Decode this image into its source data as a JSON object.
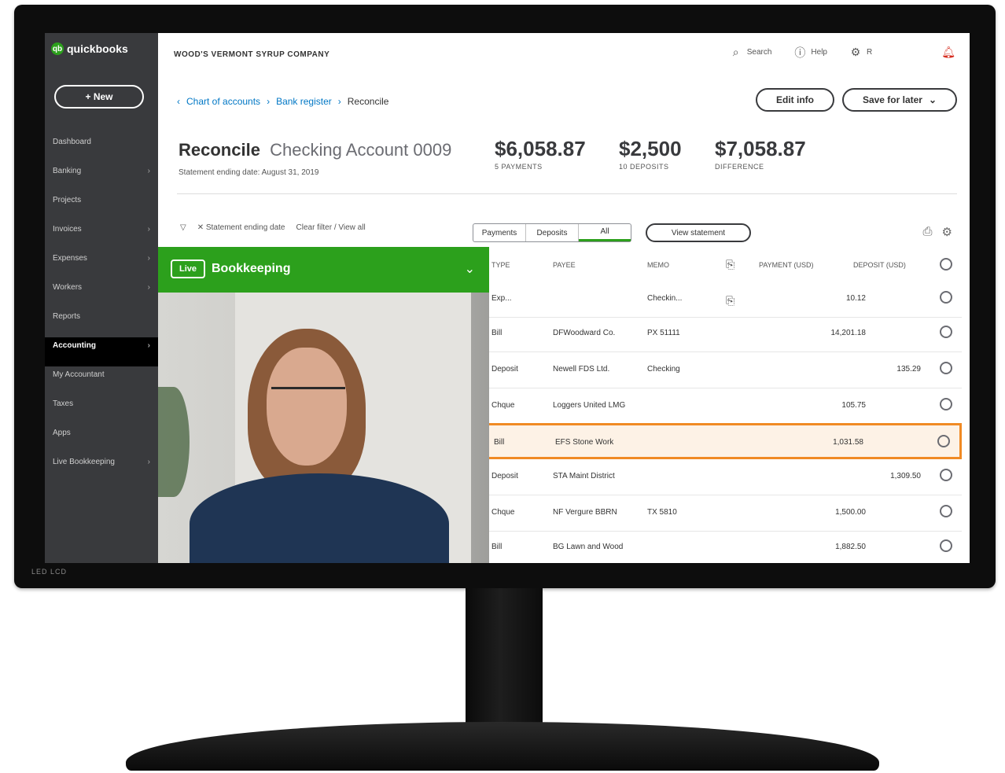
{
  "monitor": {
    "brand_text": "LED LCD"
  },
  "app": {
    "logo_text": "quickbooks",
    "new_button": "+ New",
    "company": "WOOD'S VERMONT SYRUP COMPANY",
    "search": "Search",
    "help": "Help",
    "account": "R"
  },
  "sidebar": {
    "items": [
      {
        "label": "Dashboard",
        "chevron": ""
      },
      {
        "label": "Banking",
        "chevron": "›"
      },
      {
        "label": "Projects",
        "chevron": ""
      },
      {
        "label": "Invoices",
        "chevron": "›"
      },
      {
        "label": "Expenses",
        "chevron": "›"
      },
      {
        "label": "Workers",
        "chevron": "›"
      },
      {
        "label": "Reports",
        "chevron": ""
      },
      {
        "label": "Accounting",
        "chevron": "›"
      },
      {
        "label": "My Accountant",
        "chevron": ""
      },
      {
        "label": "Taxes",
        "chevron": ""
      },
      {
        "label": "Apps",
        "chevron": ""
      },
      {
        "label": "Live Bookkeeping",
        "chevron": "›"
      }
    ]
  },
  "breadcrumb": {
    "back": "‹",
    "crumb1": "Chart of accounts",
    "crumb2": "Bank register",
    "current": "Reconcile",
    "sep": "›"
  },
  "buttons": {
    "edit_info": "Edit info",
    "save_later": "Save for later"
  },
  "reconcile": {
    "title_bold": "Reconcile",
    "title_account": "Checking Account 0009",
    "statement_date": "Statement ending date: August 31, 2019",
    "payments_amount": "$6,058.87",
    "payments_label": "5 PAYMENTS",
    "deposits_amount": "$2,500",
    "deposits_label": "10 DEPOSITS",
    "difference_amount": "$7,058.87",
    "difference_label": "DIFFERENCE"
  },
  "filters": {
    "filter_icon": "▽",
    "statement_filter": "✕ Statement ending date",
    "clear": "Clear filter / View all",
    "tabs": [
      "Payments",
      "Deposits",
      "All"
    ],
    "view_statement": "View statement"
  },
  "table": {
    "headers": {
      "type": "TYPE",
      "payee": "PAYEE",
      "memo": "MEMO",
      "payment": "PAYMENT (USD)",
      "deposit": "DEPOSIT (USD)"
    },
    "rows": [
      {
        "type": "Exp...",
        "payee": "",
        "memo": "Checkin...",
        "payment": "10.12",
        "deposit": "",
        "memo_icon": true
      },
      {
        "type": "Bill",
        "payee": "DFWoodward Co.",
        "memo": "PX 51111",
        "payment": "14,201.18",
        "deposit": "",
        "memo_icon": false
      },
      {
        "type": "Deposit",
        "payee": "Newell FDS Ltd.",
        "memo": "Checking",
        "payment": "",
        "deposit": "135.29",
        "memo_icon": false
      },
      {
        "type": "Chque",
        "payee": "Loggers United LMG",
        "memo": "",
        "payment": "105.75",
        "deposit": "",
        "memo_icon": false
      },
      {
        "type": "Bill",
        "payee": "EFS Stone Work",
        "memo": "",
        "payment": "1,031.58",
        "deposit": "",
        "memo_icon": false
      },
      {
        "type": "Deposit",
        "payee": "STA Maint District",
        "memo": "",
        "payment": "",
        "deposit": "1,309.50",
        "memo_icon": false
      },
      {
        "type": "Chque",
        "payee": "NF Vergure BBRN",
        "memo": "TX 5810",
        "payment": "1,500.00",
        "deposit": "",
        "memo_icon": false
      },
      {
        "type": "Bill",
        "payee": "BG Lawn and Wood",
        "memo": "",
        "payment": "1,882.50",
        "deposit": "",
        "memo_icon": false
      }
    ],
    "highlighted_row": 4
  },
  "video": {
    "badge": "Live",
    "title": "Bookkeeping",
    "collapse": "⌄"
  },
  "colors": {
    "brand_green": "#2ca01c",
    "highlight_orange": "#f08a24",
    "sidebar": "#393a3d"
  }
}
